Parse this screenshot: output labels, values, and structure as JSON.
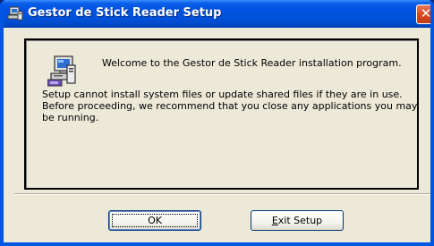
{
  "window": {
    "title": "Gestor de Stick Reader Setup",
    "close_glyph": "✕"
  },
  "content": {
    "welcome_text": "Welcome to the Gestor de Stick Reader installation program.",
    "info_lines": [
      "Setup cannot install system files or update shared files if they are in use.",
      "Before proceeding, we recommend that you close any applications you may",
      "be running."
    ]
  },
  "buttons": {
    "ok_label": "OK",
    "exit_mnemonic": "E",
    "exit_rest": "xit Setup"
  },
  "icons": {
    "title": "setup-computer-icon",
    "main": "setup-computer-icon"
  },
  "colors": {
    "titlebar": "#0054e3",
    "dialog_bg": "#ece9d8",
    "close_button": "#d9481f"
  }
}
